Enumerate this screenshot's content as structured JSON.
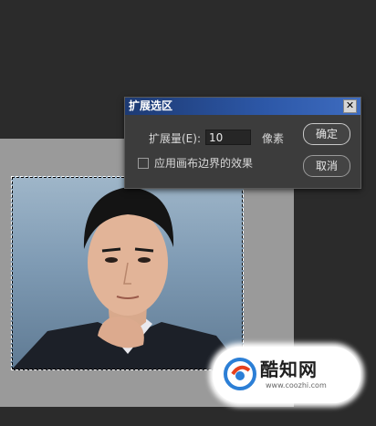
{
  "dialog": {
    "title": "扩展选区",
    "close_glyph": "✕",
    "expand_label": "扩展量(E):",
    "expand_value": "10",
    "unit": "像素",
    "checkbox_label": "应用画布边界的效果",
    "checkbox_checked": false,
    "ok_label": "确定",
    "cancel_label": "取消"
  },
  "watermark": {
    "brand": "酷知网",
    "url": "www.coozhi.com"
  },
  "colors": {
    "workspace": "#2b2b2b",
    "canvas": "#9a9a9a",
    "titlebar": "#2d58a8",
    "dialog_bg": "#3c3c3c"
  }
}
